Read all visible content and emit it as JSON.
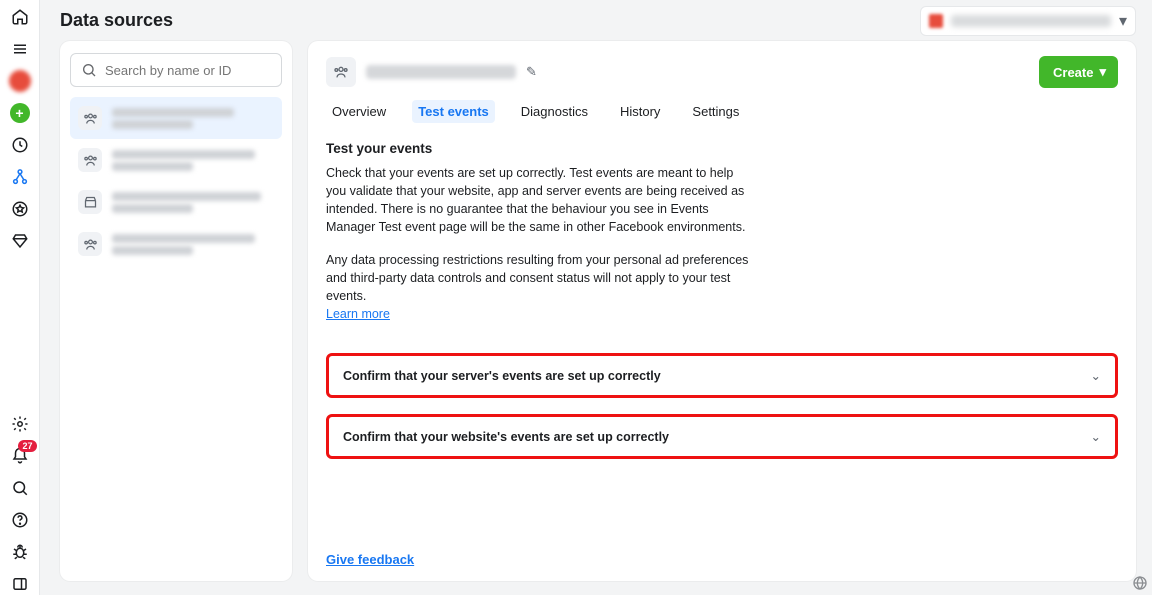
{
  "page_title": "Data sources",
  "account_picker": {
    "icon": "brand-square"
  },
  "search": {
    "placeholder": "Search by name or ID"
  },
  "data_sources": [
    {
      "icon": "audience-icon",
      "selected": true
    },
    {
      "icon": "audience-icon",
      "selected": false
    },
    {
      "icon": "storefront-icon",
      "selected": false
    },
    {
      "icon": "audience-icon",
      "selected": false
    }
  ],
  "main": {
    "header": {
      "icon": "audience-icon",
      "edit_icon": "pencil-icon"
    },
    "create_button": "Create",
    "tabs": [
      "Overview",
      "Test events",
      "Diagnostics",
      "History",
      "Settings"
    ],
    "active_tab": 1,
    "section_title": "Test your events",
    "paragraph_1": "Check that your events are set up correctly. Test events are meant to help you validate that your website, app and server events are being received as intended. There is no guarantee that the behaviour you see in Events Manager Test event page will be the same in other Facebook environments.",
    "paragraph_2": "Any data processing restrictions resulting from your personal ad preferences and third-party data controls and consent status will not apply to your test events.",
    "learn_more": "Learn more",
    "accordions": [
      "Confirm that your server's events are set up correctly",
      "Confirm that your website's events are set up correctly"
    ],
    "give_feedback": "Give feedback"
  },
  "left_rail": {
    "top_icons": [
      "home-icon",
      "menu-icon",
      "avatar",
      "plus-icon",
      "clock-icon",
      "share-icon",
      "star-icon",
      "diamond-icon"
    ],
    "bottom_icons": [
      "gear-icon",
      "bell-icon",
      "search-icon",
      "help-icon",
      "bug-icon",
      "panel-icon"
    ],
    "notification_badge": "27"
  }
}
